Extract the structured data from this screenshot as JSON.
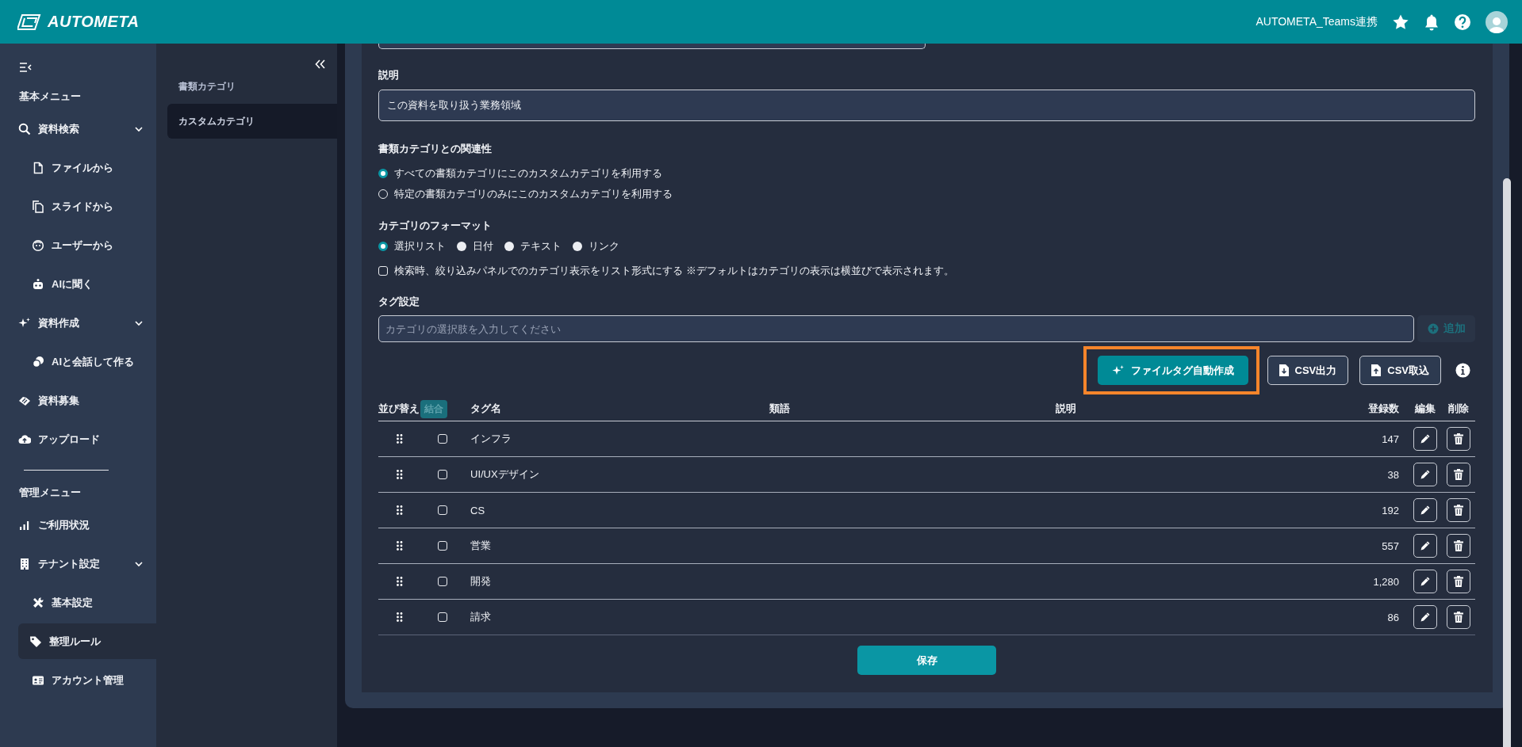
{
  "header": {
    "logo": "AUTOMETA",
    "tenant": "AUTOMETA_Teams連携"
  },
  "sidebar": {
    "sections": [
      {
        "title": "基本メニュー",
        "items": [
          {
            "label": "資料検索",
            "selected": false,
            "expanded": true,
            "children": [
              {
                "label": "ファイルから",
                "selected": false
              },
              {
                "label": "スライドから",
                "selected": false
              },
              {
                "label": "ユーザーから",
                "selected": false
              },
              {
                "label": "AIに聞く",
                "selected": false
              }
            ]
          },
          {
            "label": "資料作成",
            "selected": false,
            "expanded": true,
            "children": [
              {
                "label": "AIと会話して作る",
                "selected": false
              }
            ]
          },
          {
            "label": "資料募集",
            "selected": false
          },
          {
            "label": "アップロード",
            "selected": false
          }
        ]
      },
      {
        "title": "管理メニュー",
        "items": [
          {
            "label": "ご利用状況",
            "selected": false
          },
          {
            "label": "テナント設定",
            "selected": false,
            "expanded": true,
            "children": [
              {
                "label": "基本設定",
                "selected": false
              },
              {
                "label": "整理ルール",
                "selected": true
              },
              {
                "label": "アカウント管理",
                "selected": false
              }
            ]
          }
        ]
      }
    ]
  },
  "subnav": {
    "items": [
      {
        "label": "書類カテゴリ",
        "selected": false
      },
      {
        "label": "カスタムカテゴリ",
        "selected": true
      }
    ]
  },
  "form": {
    "description": {
      "label": "説明",
      "value": "この資料を取り扱う業務領域"
    },
    "relation": {
      "label": "書類カテゴリとの関連性",
      "kind": "outline",
      "options": [
        {
          "label": "すべての書類カテゴリにこのカスタムカテゴリを利用する",
          "selected": true
        },
        {
          "label": "特定の書類カテゴリのみにこのカスタムカテゴリを利用する",
          "selected": false
        }
      ]
    },
    "format": {
      "label": "カテゴリのフォーマット",
      "kind": "filled",
      "options": [
        {
          "label": "選択リスト",
          "selected": true
        },
        {
          "label": "日付",
          "selected": false
        },
        {
          "label": "テキスト",
          "selected": false
        },
        {
          "label": "リンク",
          "selected": false
        }
      ]
    },
    "list_display": {
      "label": "検索時、絞り込みパネルでのカテゴリ表示をリスト形式にする ※デフォルトはカテゴリの表示は横並びで表示されます。",
      "checked": false
    },
    "tags": {
      "label": "タグ設定",
      "placeholder": "カテゴリの選択肢を入力してください",
      "add_button": {
        "label": "追加",
        "disabled": true
      }
    },
    "actions": [
      {
        "label": "ファイルタグ自動作成",
        "kind": "primary",
        "highlighted": true
      },
      {
        "label": "CSV出力",
        "kind": "export",
        "highlighted": false
      },
      {
        "label": "CSV取込",
        "kind": "import",
        "highlighted": false
      }
    ],
    "table": {
      "columns": [
        {
          "label": "並び替え",
          "kind": "text"
        },
        {
          "label": "結合",
          "kind": "chip",
          "disabled": true
        },
        {
          "label": "タグ名",
          "kind": "text"
        },
        {
          "label": "類語",
          "kind": "text"
        },
        {
          "label": "説明",
          "kind": "text"
        },
        {
          "label": "登録数",
          "kind": "number"
        },
        {
          "label": "編集",
          "kind": "text"
        },
        {
          "label": "削除",
          "kind": "text"
        }
      ],
      "rows": [
        {
          "name": "インフラ",
          "count": "147",
          "checked": false
        },
        {
          "name": "UI/UXデザイン",
          "count": "38",
          "checked": false
        },
        {
          "name": "CS",
          "count": "192",
          "checked": false
        },
        {
          "name": "営業",
          "count": "557",
          "checked": false
        },
        {
          "name": "開発",
          "count": "1,280",
          "checked": false
        },
        {
          "name": "請求",
          "count": "86",
          "checked": false
        }
      ]
    },
    "save_button": "保存"
  }
}
